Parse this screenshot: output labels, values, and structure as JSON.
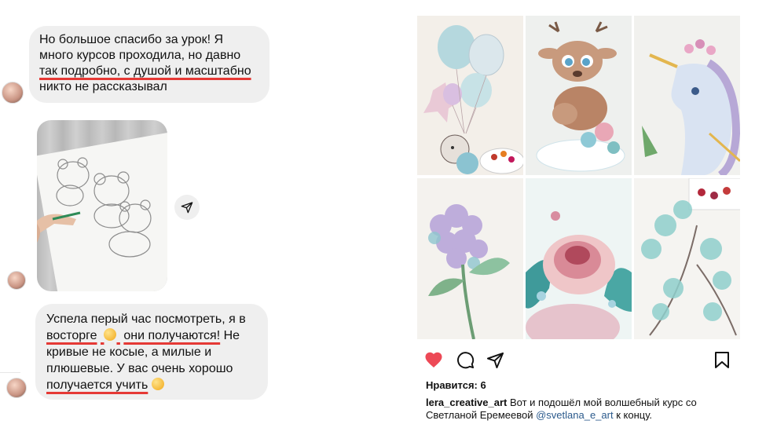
{
  "chat": {
    "message1": {
      "line1": "Но большое спасибо за урок! Я",
      "line2": "много курсов проходила, но давно",
      "line3_underlined": "так подробно, с душой и масштабно",
      "line4": "никто не рассказывал"
    },
    "message2": {
      "line1": "Успела перый час посмотреть, я в",
      "line2_underlined_a": "восторге",
      "line2_underlined_b": "они получаются!",
      "line2_rest": " Не",
      "line3": "кривые не косые, а милые и",
      "line4": "плюшевые. У вас очень хорошо",
      "line5_underlined": "получается учить"
    }
  },
  "post": {
    "likes_label": "Нравится: 6",
    "caption_user": "lera_creative_art",
    "caption_text_1": " Вот и подошёл мой волшебный курс со",
    "caption_text_2": "Светланой Еремеевой ",
    "caption_mention": "@svetlana_e_art",
    "caption_text_3": " к концу."
  },
  "colors": {
    "bubble": "#efefef",
    "underline": "#e53935",
    "like": "#ed4956"
  }
}
